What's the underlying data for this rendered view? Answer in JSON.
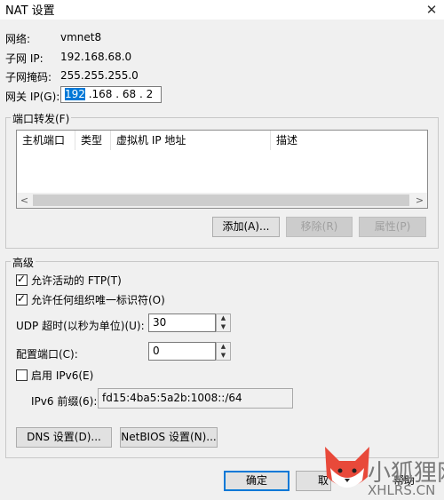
{
  "window": {
    "title": "NAT 设置",
    "close_glyph": "✕"
  },
  "info": {
    "network_label": "网络:",
    "network_value": "vmnet8",
    "subnet_ip_label": "子网 IP:",
    "subnet_ip_value": "192.168.68.0",
    "subnet_mask_label": "子网掩码:",
    "subnet_mask_value": "255.255.255.0",
    "gateway_label": "网关 IP(G):",
    "gateway_value_selected": "192",
    "gateway_value_rest": " .168 . 68 . 2"
  },
  "port_forwarding": {
    "group_label": "端口转发(F)",
    "columns": [
      "主机端口",
      "类型",
      "虚拟机 IP 地址",
      "描述"
    ],
    "rows": [],
    "scroll_left_glyph": "<",
    "scroll_right_glyph": ">",
    "add_button": "添加(A)...",
    "remove_button": "移除(R)",
    "properties_button": "属性(P)"
  },
  "advanced": {
    "group_label": "高级",
    "allow_active_ftp": {
      "label": "允许活动的 FTP(T)",
      "checked": true
    },
    "allow_any_oui": {
      "label": "允许任何组织唯一标识符(O)",
      "checked": true
    },
    "udp_timeout_label": "UDP 超时(以秒为单位)(U):",
    "udp_timeout_value": "30",
    "config_port_label": "配置端口(C):",
    "config_port_value": "0",
    "enable_ipv6": {
      "label": "启用 IPv6(E)",
      "checked": false
    },
    "ipv6_prefix_label": "IPv6 前缀(6):",
    "ipv6_prefix_value": "fd15:4ba5:5a2b:1008::/64",
    "dns_button": "DNS 设置(D)...",
    "netbios_button": "NetBIOS 设置(N)..."
  },
  "footer": {
    "ok_button": "确定",
    "cancel_button_partial": "取",
    "help_button": "帮助"
  },
  "watermark": {
    "text": "小狐狸网",
    "domain": "XHLRS.CN"
  },
  "colors": {
    "selection": "#0078d7",
    "background": "#f0f0f0",
    "watermark": "#7a7a7a"
  }
}
